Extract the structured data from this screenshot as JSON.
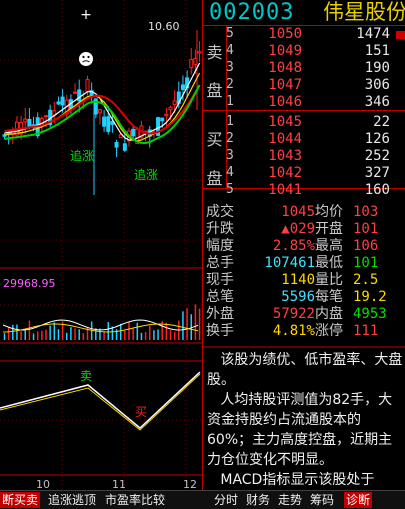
{
  "header": {
    "code": "002003",
    "name": "伟星股份"
  },
  "chart": {
    "price_label": "10.60",
    "macd_label": "29968.95",
    "mark_left": "追涨",
    "mark_right": "追涨",
    "signal_sell": "卖",
    "signal_buy": "买",
    "x_ticks": [
      "10",
      "11",
      "12"
    ],
    "colors": {
      "up": "#ff2020",
      "down": "#20d0ff",
      "ma1": "#ffffff",
      "ma2": "#ffd800",
      "ma3": "#00d000",
      "ma4": "#e00000"
    }
  },
  "orderbook": {
    "sell_label_1": "卖",
    "sell_label_2": "盘",
    "buy_label_1": "买",
    "buy_label_2": "盘",
    "asks": [
      {
        "n": "5",
        "price": "1050",
        "vol": "1474"
      },
      {
        "n": "4",
        "price": "1049",
        "vol": "151"
      },
      {
        "n": "3",
        "price": "1048",
        "vol": "190"
      },
      {
        "n": "2",
        "price": "1047",
        "vol": "306"
      },
      {
        "n": "1",
        "price": "1046",
        "vol": "346"
      }
    ],
    "bids": [
      {
        "n": "1",
        "price": "1045",
        "vol": "22"
      },
      {
        "n": "2",
        "price": "1044",
        "vol": "126"
      },
      {
        "n": "3",
        "price": "1043",
        "vol": "252"
      },
      {
        "n": "4",
        "price": "1042",
        "vol": "327"
      },
      {
        "n": "5",
        "price": "1041",
        "vol": "160"
      }
    ]
  },
  "stats": [
    {
      "l1": "成交",
      "v1": "1045",
      "l2": "均价",
      "v2": "103"
    },
    {
      "l1": "升跌",
      "v1": "▲029",
      "l2": "开盘",
      "v2": "101"
    },
    {
      "l1": "幅度",
      "v1": "2.85%",
      "l2": "最高",
      "v2": "106"
    },
    {
      "l1": "总手",
      "v1": "107461",
      "l2": "最低",
      "v2": "101"
    },
    {
      "l1": "现手",
      "v1": "1140",
      "l2": "量比",
      "v2": "2.5"
    },
    {
      "l1": "总笔",
      "v1": "5596",
      "l2": "每笔",
      "v2": "19.2"
    },
    {
      "l1": "外盘",
      "v1": "57922",
      "l2": "内盘",
      "v2": "4953"
    },
    {
      "l1": "换手",
      "v1": "4.81%",
      "l2": "涨停",
      "v2": "111"
    }
  ],
  "note": "   该股为绩优、低市盈率、大盘股。\n   人均持股评测值为82手，大资金持股约占流通股本的60%；主力高度控盘，近期主力仓位变化不明显。\n   MACD指标显示该股处于",
  "tabs": [
    "断买卖",
    "追涨逃顶",
    "市盈率比较",
    "分时",
    "财务",
    "走势",
    "筹码",
    "诊断"
  ]
}
